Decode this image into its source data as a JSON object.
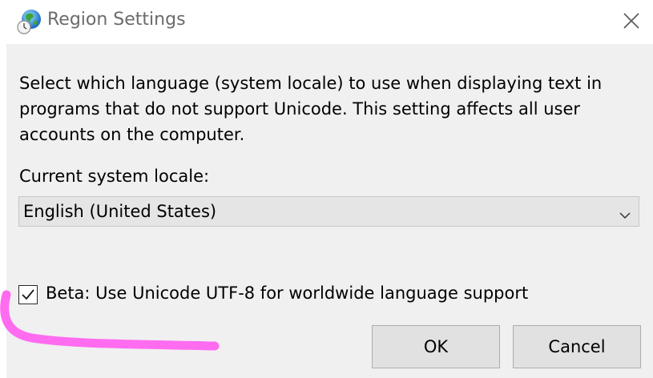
{
  "window": {
    "title": "Region Settings",
    "icon": "globe-clock-icon",
    "close_icon": "close-icon"
  },
  "dialog": {
    "description": "Select which language (system locale) to use when displaying text in programs that do not support Unicode. This setting affects all user accounts on the computer.",
    "locale_label": "Current system locale:",
    "locale_select": {
      "selected_value": "English (United States)",
      "dropdown_icon": "chevron-down-icon"
    },
    "utf8_option": {
      "label": "Beta: Use Unicode UTF-8 for worldwide language support",
      "checked": true
    },
    "buttons": {
      "ok_label": "OK",
      "cancel_label": "Cancel"
    }
  },
  "annotation": {
    "color": "#ff6cf0",
    "description_note": "pink hand-drawn underline annotation"
  },
  "colors": {
    "dialog_background": "#f0f0f0",
    "button_background": "#e1e1e1",
    "title_text": "#6b6b6b"
  }
}
